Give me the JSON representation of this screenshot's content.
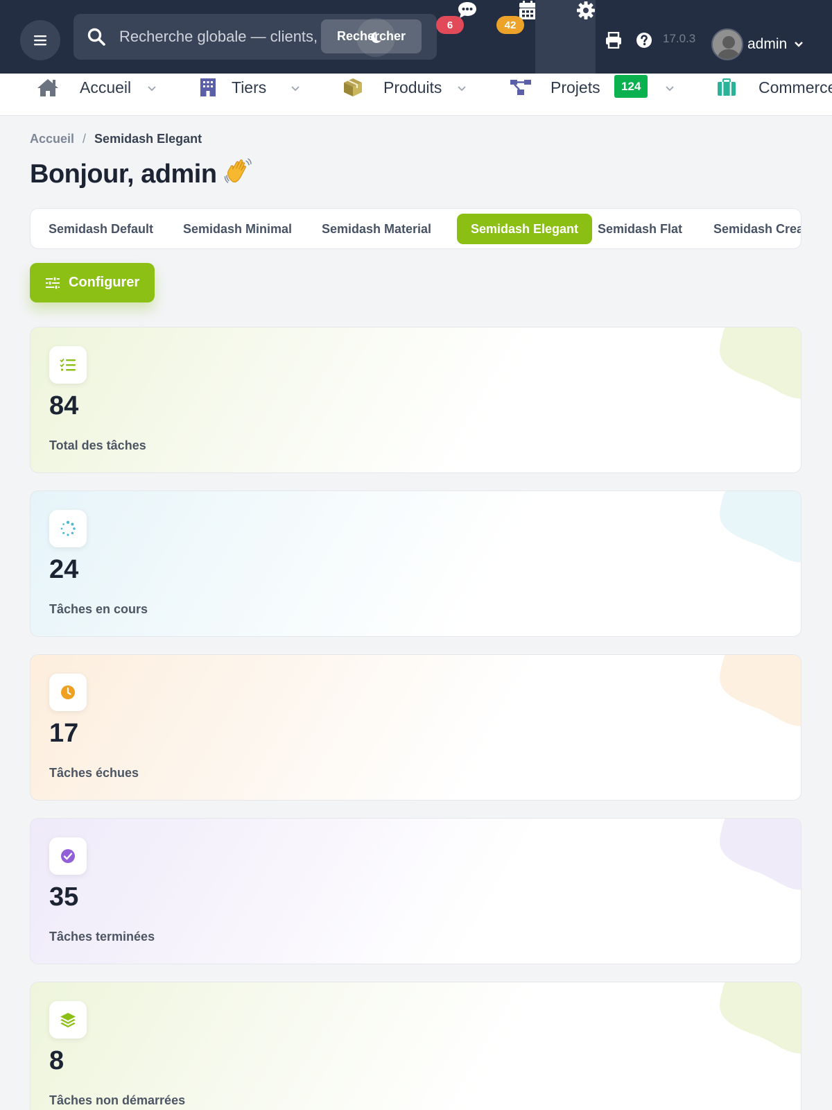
{
  "topbar": {
    "search": {
      "placeholder": "Recherche globale — clients, produits, factures…",
      "button_label": "Rechercher"
    },
    "messages_count": "6",
    "agenda_count": "42",
    "version": "17.0.3",
    "user_name": "admin",
    "icons": [
      "menu-icon",
      "search-icon",
      "moon-icon",
      "chat-icon",
      "calendar-icon",
      "gear-icon",
      "print-icon",
      "help-icon",
      "avatar",
      "chevron-down-icon"
    ]
  },
  "nav": {
    "items": [
      {
        "label": "Accueil",
        "icon": "home-icon"
      },
      {
        "label": "Tiers",
        "icon": "building-icon"
      },
      {
        "label": "Produits",
        "icon": "box-icon"
      },
      {
        "label": "Projets",
        "icon": "project-icon",
        "badge": "124"
      },
      {
        "label": "Commerce",
        "icon": "suitcase-icon"
      }
    ]
  },
  "breadcrumb": {
    "home": "Accueil",
    "separator": "/",
    "current": "Semidash Elegant"
  },
  "greeting": "Bonjour, admin",
  "tabs": [
    "Semidash Default",
    "Semidash Minimal",
    "Semidash Material",
    "Semidash Elegant",
    "Semidash Flat",
    "Semidash Creative"
  ],
  "active_tab": "Semidash Elegant",
  "configure_label": "Configurer",
  "stats": [
    {
      "value": "84",
      "label": "Total des tâches",
      "icon": "task-list-icon",
      "color": "#8cbf13"
    },
    {
      "value": "24",
      "label": "Tâches en cours",
      "icon": "spinner-icon",
      "color": "#4cb8d4"
    },
    {
      "value": "17",
      "label": "Tâches échues",
      "icon": "clock-icon",
      "color": "#ef9f22"
    },
    {
      "value": "35",
      "label": "Tâches terminées",
      "icon": "check-circle-icon",
      "color": "#9160d6"
    },
    {
      "value": "8",
      "label": "Tâches non démarrées",
      "icon": "layers-icon",
      "color": "#8cbf13"
    }
  ],
  "colors": {
    "topbar": "#242e42",
    "accent": "#8cbf13",
    "badge_red": "#e24a5a",
    "badge_orange": "#eda22a",
    "badge_green": "#0bb04f"
  }
}
